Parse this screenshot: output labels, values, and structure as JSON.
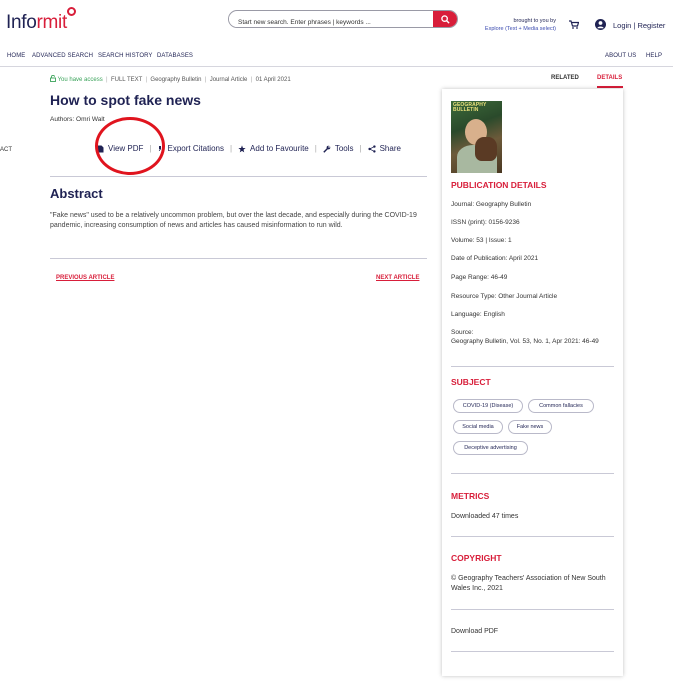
{
  "header": {
    "logo_main": "Info",
    "logo_accent": "rmit",
    "search_placeholder": "Start new search. Enter phrases | keywords ...",
    "brought_line1": "brought to you by",
    "brought_line2": "Explore (Text + Media select)",
    "login_label": "Login | Register"
  },
  "nav": {
    "home": "HOME",
    "advanced_search": "ADVANCED SEARCH",
    "search_history": "SEARCH HISTORY",
    "databases": "DATABASES",
    "about_us": "ABOUT US",
    "help": "HELP"
  },
  "article": {
    "access": "You have access",
    "full_text": "FULL TEXT",
    "journal": "Geography Bulletin",
    "type": "Journal Article",
    "date": "01 April 2021",
    "title": "How to spot fake news",
    "authors": "Authors: Omri Walt",
    "left_edge_label": "ACT",
    "actions": {
      "view_pdf": "View PDF",
      "export": "Export Citations",
      "favourite": "Add to Favourite",
      "tools": "Tools",
      "share": "Share"
    },
    "abstract_heading": "Abstract",
    "abstract_text": "\"Fake news\" used to be a relatively uncommon problem, but over the last decade, and especially during the COVID-19 pandemic, increasing consumption of news and articles has caused misinformation to run wild.",
    "prev": "PREVIOUS ARTICLE",
    "next": "NEXT ARTICLE"
  },
  "sidebar": {
    "tab_related": "RELATED",
    "tab_details": "DETAILS",
    "cover_title": "GEOGRAPHY BULLETIN",
    "pub_heading": "PUBLICATION DETAILS",
    "journal": "Journal: Geography Bulletin",
    "issn": "ISSN (print): 0156-9236",
    "volume": "Volume: 53 | Issue: 1",
    "date_pub": "Date of Publication: April 2021",
    "page_range": "Page Range: 46-49",
    "resource_type": "Resource Type: Other Journal Article",
    "language": "Language: English",
    "source_label": "Source:",
    "source_text": "Geography Bulletin, Vol. 53, No. 1, Apr 2021: 46-49",
    "subject_heading": "SUBJECT",
    "subjects": [
      "COVID-19 (Disease)",
      "Common fallacies",
      "Social media",
      "Fake news",
      "Deceptive advertising"
    ],
    "metrics_heading": "METRICS",
    "metrics_text": "Downloaded 47 times",
    "copyright_heading": "COPYRIGHT",
    "copyright_text": "© Geography Teachers' Association of New South Wales Inc., 2021",
    "download_pdf": "Download PDF"
  },
  "colors": {
    "brand_red": "#d81e3a",
    "navy": "#1f2253",
    "access_green": "#3aa35a",
    "annotation_circle": "#e0141e"
  }
}
